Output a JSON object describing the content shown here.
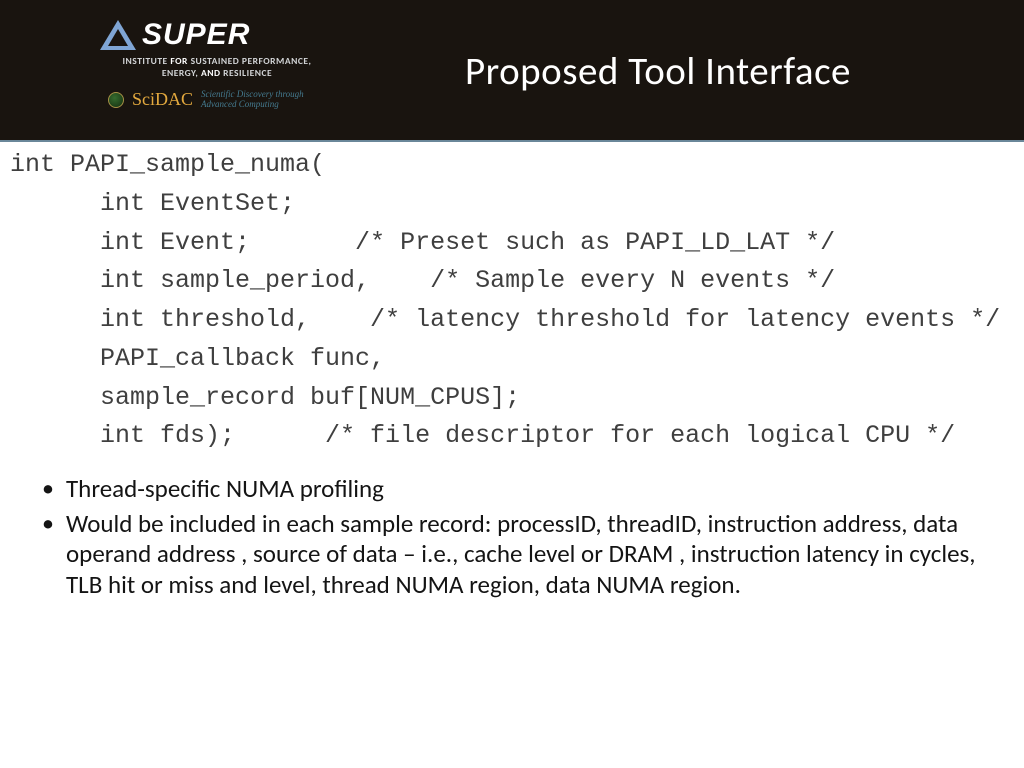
{
  "header": {
    "logo_word": "SUPER",
    "institute_line_pre": "INSTITUTE ",
    "institute_line_for": "FOR ",
    "institute_line_mid": "SUSTAINED PERFORMANCE,\nENERGY, ",
    "institute_line_and": "AND ",
    "institute_line_end": "RESILIENCE",
    "scidac": "SciDAC",
    "scidac_tag": "Scientific Discovery through Advanced Computing",
    "title": "Proposed Tool Interface"
  },
  "code": "int PAPI_sample_numa(\n      int EventSet;\n      int Event;       /* Preset such as PAPI_LD_LAT */\n      int sample_period,    /* Sample every N events */\n      int threshold,    /* latency threshold for latency events */\n      PAPI_callback func,\n      sample_record buf[NUM_CPUS];\n      int fds);      /* file descriptor for each logical CPU */",
  "bullets": {
    "b1": "Thread-specific NUMA profiling",
    "b2": "Would be included in each sample record:  processID, threadID, instruction address, data operand address , source of data – i.e., cache level or DRAM , instruction latency in cycles, TLB hit or miss and level, thread NUMA region, data NUMA region."
  }
}
